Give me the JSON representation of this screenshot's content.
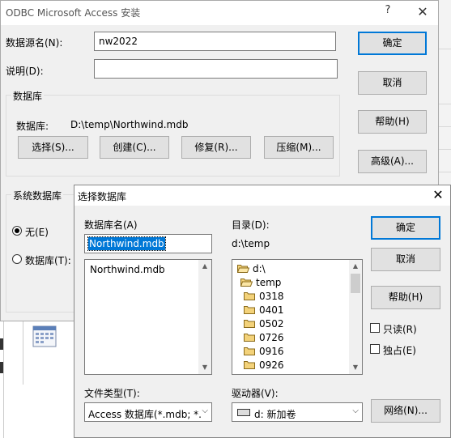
{
  "odbc_dialog": {
    "title": "ODBC Microsoft Access 安装",
    "help_glyph": "?",
    "close_glyph": "✕",
    "data_source_name_label": "数据源名(N):",
    "data_source_name_value": "nw2022",
    "description_label": "说明(D):",
    "description_value": "",
    "database_group_title": "数据库",
    "database_label": "数据库:",
    "database_path": "D:\\temp\\Northwind.mdb",
    "buttons": {
      "select": "选择(S)...",
      "create": "创建(C)...",
      "repair": "修复(R)...",
      "compact": "压缩(M)...",
      "ok": "确定",
      "cancel": "取消",
      "help": "帮助(H)",
      "advanced": "高级(A)..."
    },
    "system_db_group_title": "系统数据库",
    "radio_none": "无(E)",
    "radio_database": "数据库(T):"
  },
  "select_db_dialog": {
    "title": "选择数据库",
    "close_glyph": "✕",
    "db_name_label": "数据库名(A)",
    "db_name_value": "Northwind.mdb",
    "directory_label": "目录(D):",
    "directory_value": "d:\\temp",
    "files": [
      "Northwind.mdb"
    ],
    "folders": [
      "d:\\",
      "temp",
      "0318",
      "0401",
      "0502",
      "0726",
      "0916",
      "0926"
    ],
    "file_type_label": "文件类型(T):",
    "file_type_value": "Access 数据库(*.mdb; *.",
    "drives_label": "驱动器(V):",
    "drive_value": "d: 新加卷",
    "buttons": {
      "ok": "确定",
      "cancel": "取消",
      "help": "帮助(H)",
      "network": "网络(N)..."
    },
    "readonly_label": "只读(R)",
    "exclusive_label": "独占(E)"
  },
  "colors": {
    "dialog_bg": "#f0f0f0",
    "selection": "#0078d7",
    "folder": "#e8b84a"
  }
}
